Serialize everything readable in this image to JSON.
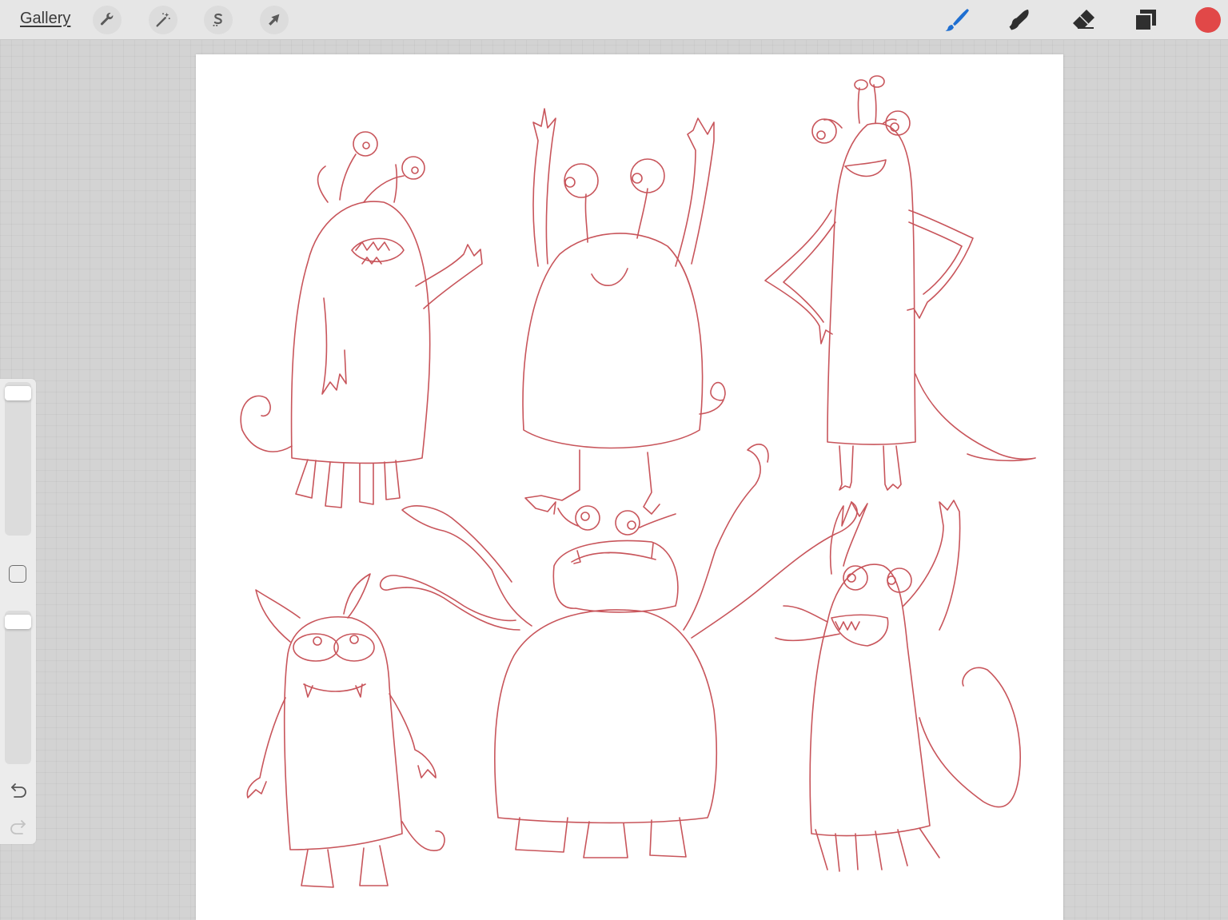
{
  "toolbar": {
    "gallery_label": "Gallery",
    "left_tools": [
      {
        "name": "actions",
        "icon": "wrench-icon"
      },
      {
        "name": "adjustments",
        "icon": "magic-wand-icon"
      },
      {
        "name": "selection",
        "icon": "selection-s-icon"
      },
      {
        "name": "transform",
        "icon": "arrow-cursor-icon"
      }
    ],
    "right_tools": [
      {
        "name": "brush",
        "icon": "brush-icon",
        "active": true,
        "color": "#1f6fd1"
      },
      {
        "name": "smudge",
        "icon": "smudge-finger-icon",
        "active": false
      },
      {
        "name": "eraser",
        "icon": "eraser-icon",
        "active": false
      },
      {
        "name": "layers",
        "icon": "layers-icon",
        "active": false
      }
    ],
    "current_color": "#e14848"
  },
  "sidebar": {
    "brush_size_level": 0.98,
    "opacity_level": 0.98,
    "modify_button_icon": "square-icon",
    "undo_icon": "undo-arrow-icon",
    "redo_icon": "redo-arrow-icon",
    "redo_enabled": false
  },
  "canvas": {
    "background": "#ffffff",
    "stroke_color": "#c8555b",
    "content": "sketch-six-monsters"
  }
}
